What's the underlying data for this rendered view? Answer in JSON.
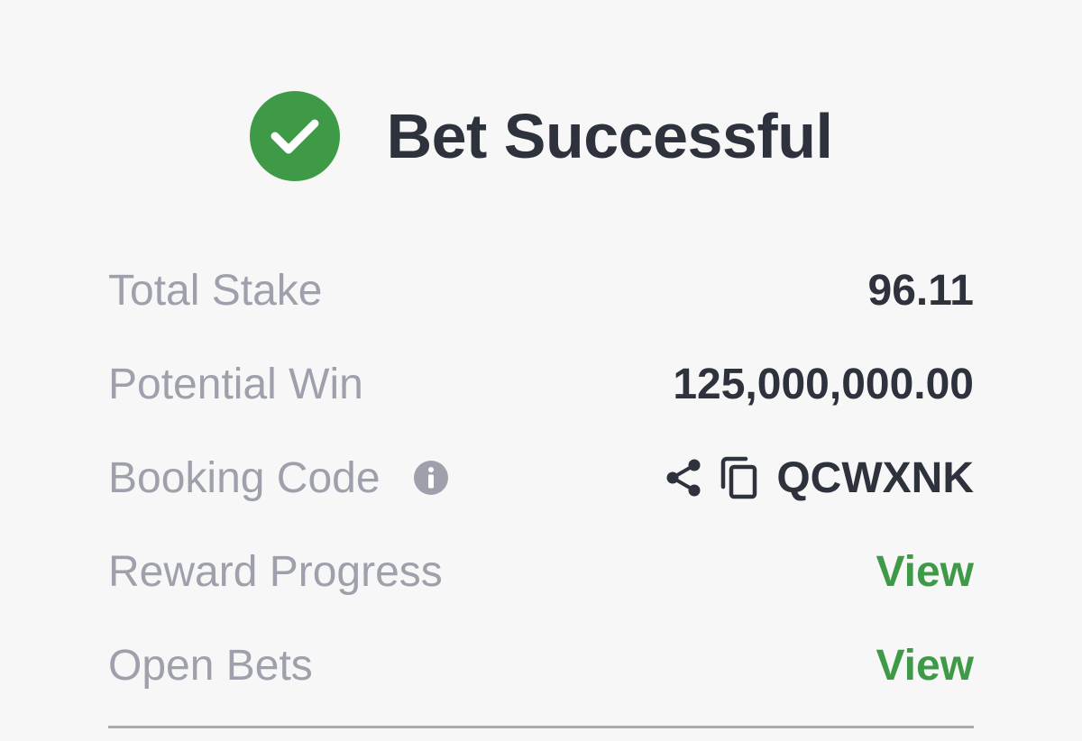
{
  "colors": {
    "success": "#3f9a48",
    "text_primary": "#2e323c",
    "text_muted": "#9ea0ab",
    "link": "#3f9a48"
  },
  "header": {
    "icon": "check-circle-icon",
    "title": "Bet Successful"
  },
  "summary": {
    "total_stake": {
      "label": "Total Stake",
      "value": "96.11"
    },
    "potential_win": {
      "label": "Potential Win",
      "value": "125,000,000.00"
    },
    "booking_code": {
      "label": "Booking Code",
      "info_icon": "info-icon",
      "share_icon": "share-icon",
      "copy_icon": "copy-icon",
      "value": "QCWXNK"
    },
    "reward_progress": {
      "label": "Reward Progress",
      "link": "View"
    },
    "open_bets": {
      "label": "Open Bets",
      "link": "View"
    }
  }
}
